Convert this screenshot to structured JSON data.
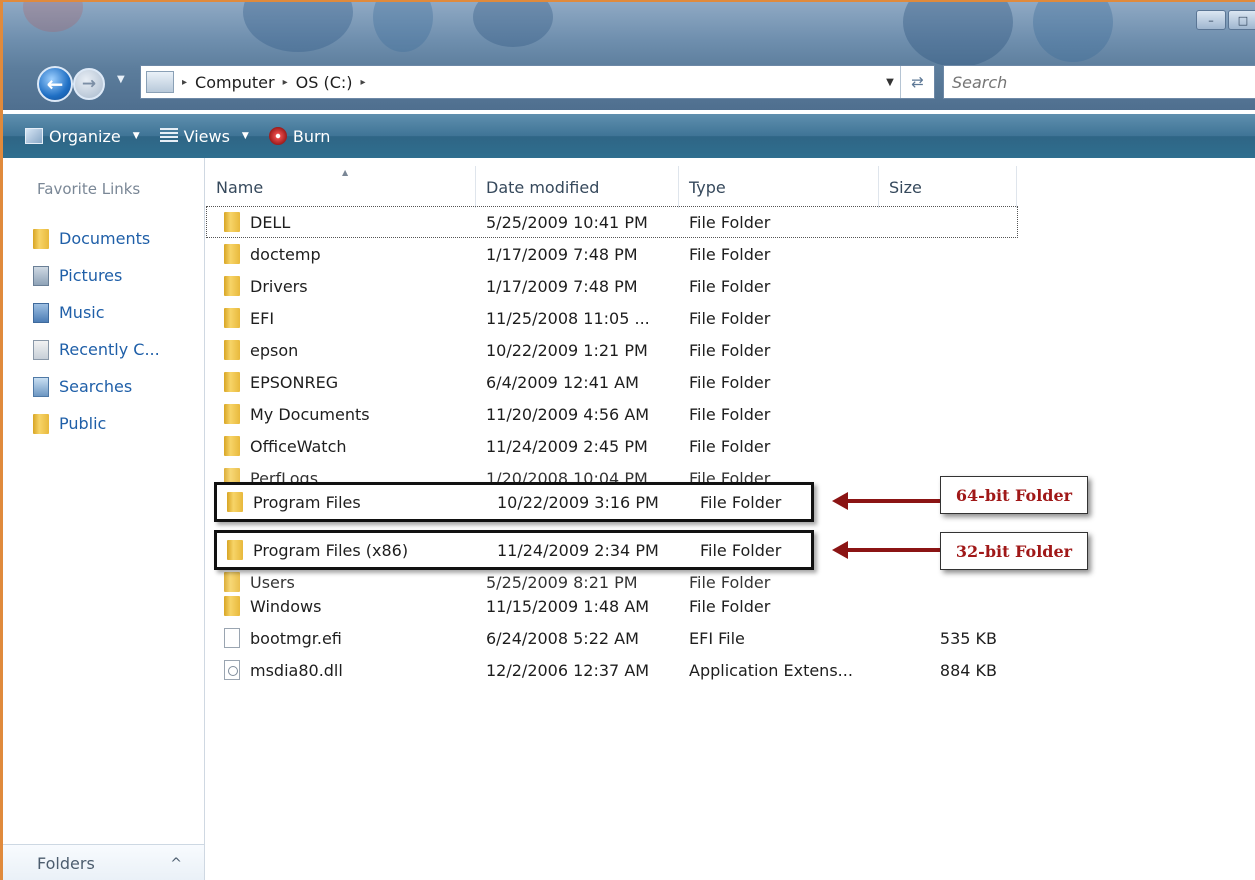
{
  "window": {
    "controls": [
      "–",
      "□"
    ]
  },
  "address_bar": {
    "breadcrumbs": [
      "Computer",
      "OS (C:)"
    ],
    "separator": "▸"
  },
  "search": {
    "placeholder": "Search"
  },
  "toolbar": {
    "organize": "Organize",
    "views": "Views",
    "burn": "Burn"
  },
  "nav_pane": {
    "heading": "Favorite Links",
    "items": [
      {
        "label": "Documents",
        "icon": "documents-folder-icon"
      },
      {
        "label": "Pictures",
        "icon": "pictures-icon"
      },
      {
        "label": "Music",
        "icon": "music-icon"
      },
      {
        "label": "Recently C...",
        "icon": "recent-icon"
      },
      {
        "label": "Searches",
        "icon": "searches-icon"
      },
      {
        "label": "Public",
        "icon": "public-folder-icon"
      }
    ],
    "folders_label": "Folders",
    "folders_chevron": "^"
  },
  "file_list": {
    "columns": [
      "Name",
      "Date modified",
      "Type",
      "Size"
    ],
    "rows": [
      {
        "name": "DELL",
        "date": "5/25/2009 10:41 PM",
        "type": "File Folder",
        "size": "",
        "icon": "folder-icon"
      },
      {
        "name": "doctemp",
        "date": "1/17/2009 7:48 PM",
        "type": "File Folder",
        "size": "",
        "icon": "folder-icon"
      },
      {
        "name": "Drivers",
        "date": "1/17/2009 7:48 PM",
        "type": "File Folder",
        "size": "",
        "icon": "folder-icon"
      },
      {
        "name": "EFI",
        "date": "11/25/2008 11:05 ...",
        "type": "File Folder",
        "size": "",
        "icon": "folder-icon"
      },
      {
        "name": "epson",
        "date": "10/22/2009 1:21 PM",
        "type": "File Folder",
        "size": "",
        "icon": "folder-icon"
      },
      {
        "name": "EPSONREG",
        "date": "6/4/2009 12:41 AM",
        "type": "File Folder",
        "size": "",
        "icon": "folder-icon"
      },
      {
        "name": "My Documents",
        "date": "11/20/2009 4:56 AM",
        "type": "File Folder",
        "size": "",
        "icon": "folder-icon"
      },
      {
        "name": "OfficeWatch",
        "date": "11/24/2009 2:45 PM",
        "type": "File Folder",
        "size": "",
        "icon": "folder-icon"
      },
      {
        "name": "PerfLogs",
        "date": "1/20/2008 10:04 PM",
        "type": "File Folder",
        "size": "",
        "icon": "folder-icon"
      },
      {
        "name": "Program Files",
        "date": "10/22/2009 3:16 PM",
        "type": "File Folder",
        "size": "",
        "icon": "folder-icon"
      },
      {
        "name": "Program Files (x86)",
        "date": "11/24/2009 2:34 PM",
        "type": "File Folder",
        "size": "",
        "icon": "folder-icon"
      },
      {
        "name": "Users",
        "date": "5/25/2009 8:21 PM",
        "type": "File Folder",
        "size": "",
        "icon": "folder-icon"
      },
      {
        "name": "Windows",
        "date": "11/15/2009 1:48 AM",
        "type": "File Folder",
        "size": "",
        "icon": "folder-icon"
      },
      {
        "name": "bootmgr.efi",
        "date": "6/24/2008 5:22 AM",
        "type": "EFI File",
        "size": "535 KB",
        "icon": "file-icon"
      },
      {
        "name": "msdia80.dll",
        "date": "12/2/2006 12:37 AM",
        "type": "Application Extens...",
        "size": "884 KB",
        "icon": "dll-file-icon"
      }
    ]
  },
  "annotations": {
    "label_64": "64-bit Folder",
    "label_32": "32-bit Folder",
    "arrow_color": "#8b1414",
    "label_color": "#a01818"
  },
  "colors": {
    "link_blue": "#1f5fa8",
    "toolbar": "#3f7496",
    "window_border": "#e08a3c"
  }
}
